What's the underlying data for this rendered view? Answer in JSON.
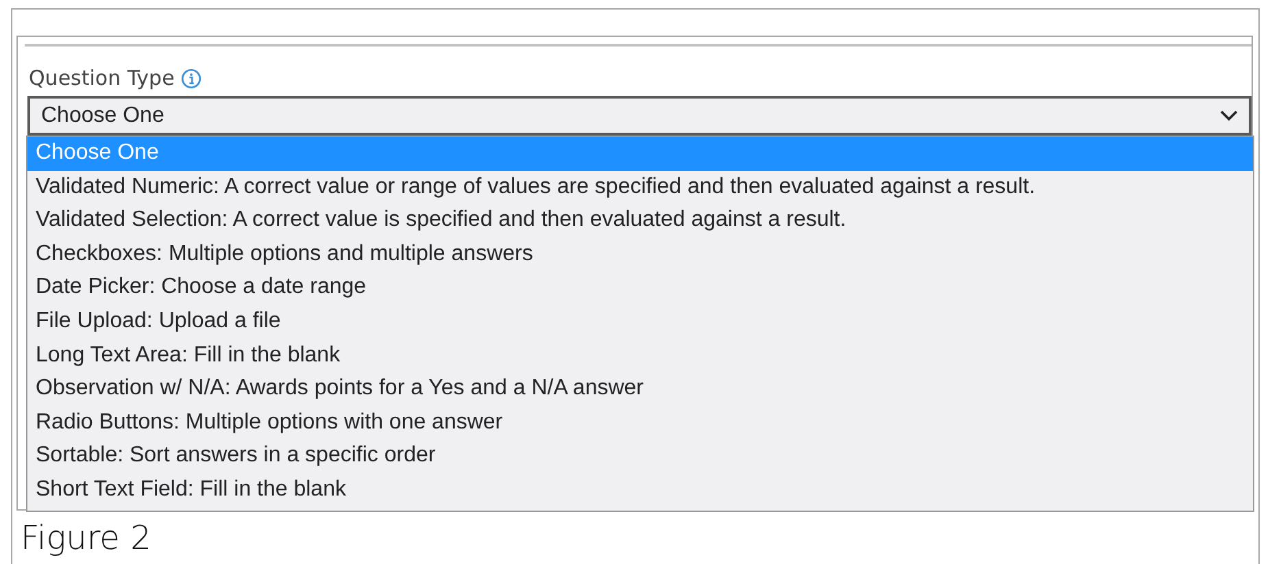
{
  "field": {
    "label": "Question Type",
    "value": "Choose One"
  },
  "dropdown": {
    "options": [
      {
        "label": "Choose One",
        "selected": true
      },
      {
        "label": "Validated Numeric: A correct value or range of values are specified and then evaluated against a result.",
        "selected": false
      },
      {
        "label": "Validated Selection: A correct value is specified and then evaluated against a result.",
        "selected": false
      },
      {
        "label": "Checkboxes: Multiple options and multiple answers",
        "selected": false
      },
      {
        "label": "Date Picker: Choose a date range",
        "selected": false
      },
      {
        "label": "File Upload: Upload a file",
        "selected": false
      },
      {
        "label": "Long Text Area: Fill in the blank",
        "selected": false
      },
      {
        "label": "Observation w/ N/A: Awards points for a Yes and a N/A answer",
        "selected": false
      },
      {
        "label": "Radio Buttons: Multiple options with one answer",
        "selected": false
      },
      {
        "label": "Sortable: Sort answers in a specific order",
        "selected": false
      },
      {
        "label": "Short Text Field: Fill in the blank",
        "selected": false
      }
    ]
  },
  "caption": "Figure 2"
}
